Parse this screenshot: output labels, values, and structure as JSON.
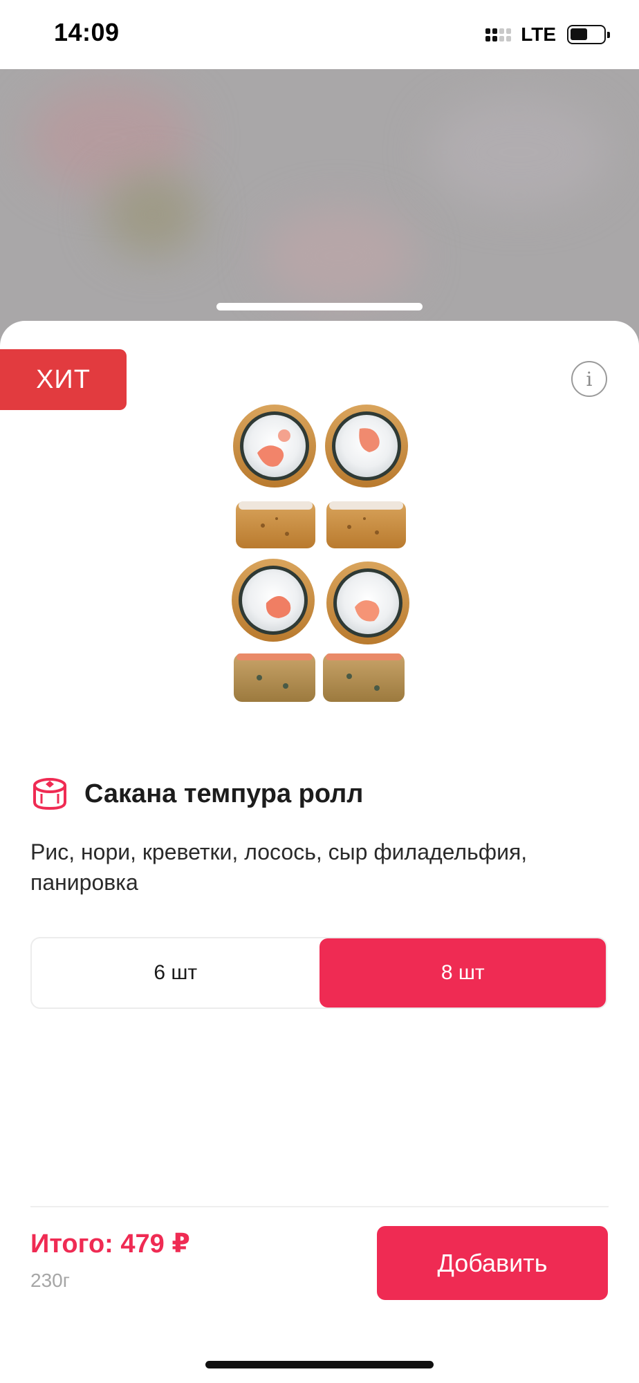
{
  "status_bar": {
    "time": "14:09",
    "network": "LTE",
    "icons": [
      "signal-icon",
      "battery-icon"
    ]
  },
  "product": {
    "badge": "ХИТ",
    "info_icon": "i",
    "image_alt": "sushi rolls image",
    "category_icon": "roll-icon",
    "title": "Сакана темпура ролл",
    "description": "Рис, нори, креветки, лосось, сыр филадельфия, панировка"
  },
  "size_options": {
    "options": [
      {
        "label": "6 шт",
        "selected": false
      },
      {
        "label": "8 шт",
        "selected": true
      }
    ]
  },
  "footer": {
    "total": "Итого: 479 ₽",
    "weight": "230г",
    "add_label": "Добавить"
  },
  "colors": {
    "accent": "#ef2b53",
    "badge": "#e23b3f",
    "backdrop": "#a9a7a8"
  }
}
